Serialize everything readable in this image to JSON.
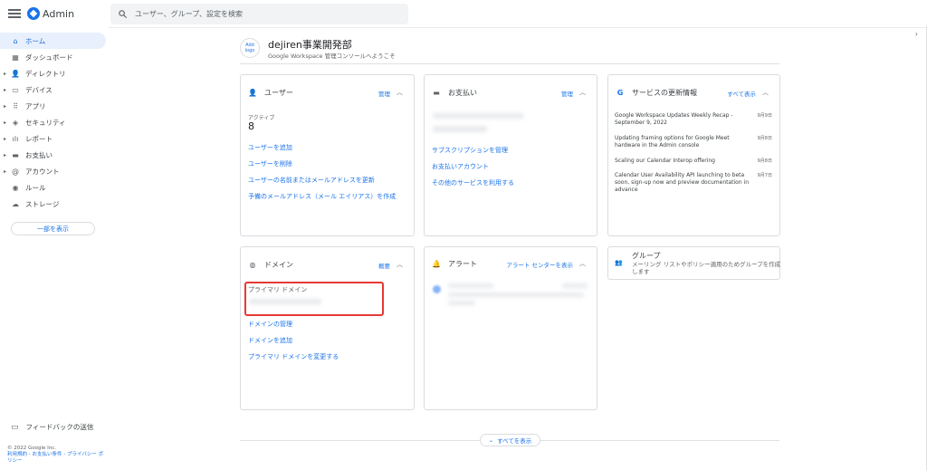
{
  "header": {
    "app_title": "Admin",
    "search_placeholder": "ユーザー、グループ、設定を検索"
  },
  "sidebar": {
    "items": [
      {
        "label": "ホーム",
        "icon": "home-icon"
      },
      {
        "label": "ダッシュボード",
        "icon": "dashboard-icon"
      },
      {
        "label": "ディレクトリ",
        "icon": "person-icon"
      },
      {
        "label": "デバイス",
        "icon": "devices-icon"
      },
      {
        "label": "アプリ",
        "icon": "apps-grid-icon"
      },
      {
        "label": "セキュリティ",
        "icon": "shield-icon"
      },
      {
        "label": "レポート",
        "icon": "bar-chart-icon"
      },
      {
        "label": "お支払い",
        "icon": "credit-card-icon"
      },
      {
        "label": "アカウント",
        "icon": "at-icon"
      },
      {
        "label": "ルール",
        "icon": "rule-icon"
      },
      {
        "label": "ストレージ",
        "icon": "cloud-icon"
      }
    ],
    "show_part_label": "一部を表示",
    "feedback_label": "フィードバックの送信",
    "footer_copyright": "© 2022 Google Inc.",
    "footer_links": "利用規約 - お支払い条件 - プライバシー ポリシー"
  },
  "org": {
    "logo_line1": "Add",
    "logo_line2": "logo",
    "name": "dejiren事業開発部",
    "welcome": "Google Workspace 管理コンソールへようこそ"
  },
  "users_card": {
    "title": "ユーザー",
    "manage": "管理",
    "active_label": "アクティブ",
    "active_count": "8",
    "links": [
      "ユーザーを追加",
      "ユーザーを削除",
      "ユーザーの名前またはメールアドレスを更新",
      "予備のメールアドレス（メール エイリアス）を作成"
    ]
  },
  "billing_card": {
    "title": "お支払い",
    "manage": "管理",
    "links": [
      "サブスクリプションを管理",
      "お支払いアカウント",
      "その他のサービスを利用する"
    ]
  },
  "updates_card": {
    "title": "サービスの更新情報",
    "show_all": "すべて表示",
    "items": [
      {
        "text": "Google Workspace Updates Weekly Recap - September 9, 2022",
        "date": "9月9日"
      },
      {
        "text": "Updating framing options for Google Meet hardware in the Admin console",
        "date": "9月8日"
      },
      {
        "text": "Scaling our Calendar Interop offering",
        "date": "9月8日"
      },
      {
        "text": "Calendar User Availability API launching to beta soon, sign-up now and preview documentation in advance",
        "date": "9月7日"
      }
    ]
  },
  "domain_card": {
    "title": "ドメイン",
    "overview": "概要",
    "primary_label": "プライマリ ドメイン",
    "links": [
      "ドメインの管理",
      "ドメインを追加",
      "プライマリ ドメインを変更する"
    ]
  },
  "alerts_card": {
    "title": "アラート",
    "alert_center": "アラート センターを表示"
  },
  "groups_card": {
    "title": "グループ",
    "desc": "メーリング リストやポリシー適用のためグループを作成します"
  },
  "show_all_label": "すべてを表示"
}
